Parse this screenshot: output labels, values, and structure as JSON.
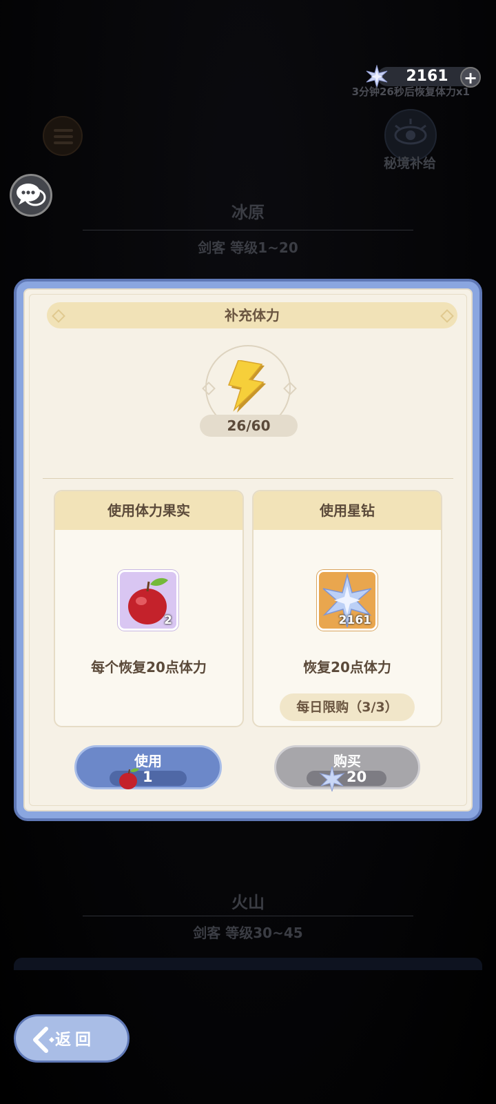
{
  "header": {
    "gem_count": "2161",
    "recover_timer": "3分钟26秒后恢复体力x1",
    "supply_label": "秘境补给"
  },
  "zones": [
    {
      "name": "冰原",
      "requirement": "剑客  等级1~20"
    },
    {
      "name": "火山",
      "requirement": "剑客  等级30~45"
    }
  ],
  "dialog": {
    "title": "补充体力",
    "stamina": "26/60",
    "fruit_option": {
      "title": "使用体力果实",
      "item_count": "2",
      "description": "每个恢复20点体力",
      "button_label": "使用",
      "button_count": "1"
    },
    "gem_option": {
      "title": "使用星钻",
      "item_count": "2161",
      "description": "恢复20点体力",
      "limit": "每日限购（3/3）",
      "button_label": "购买",
      "button_count": "20"
    }
  },
  "footer": {
    "back_label": "返回"
  },
  "icons": {
    "gem": "star-gem-icon",
    "stamina": "lightning-icon",
    "fruit": "apple-icon",
    "chat": "chat-bubbles-icon",
    "menu": "list-icon",
    "supply": "eye-icon",
    "back": "back-arrow-icon",
    "plus": "plus-icon"
  },
  "colors": {
    "dialog_frame": "#8aa6e0",
    "dialog_bg": "#f6f1e6",
    "banner": "#f1e2b7",
    "use_button": "#6c88c9",
    "buy_button_disabled": "#a7a6aa",
    "text_brown": "#5b4a3a"
  }
}
